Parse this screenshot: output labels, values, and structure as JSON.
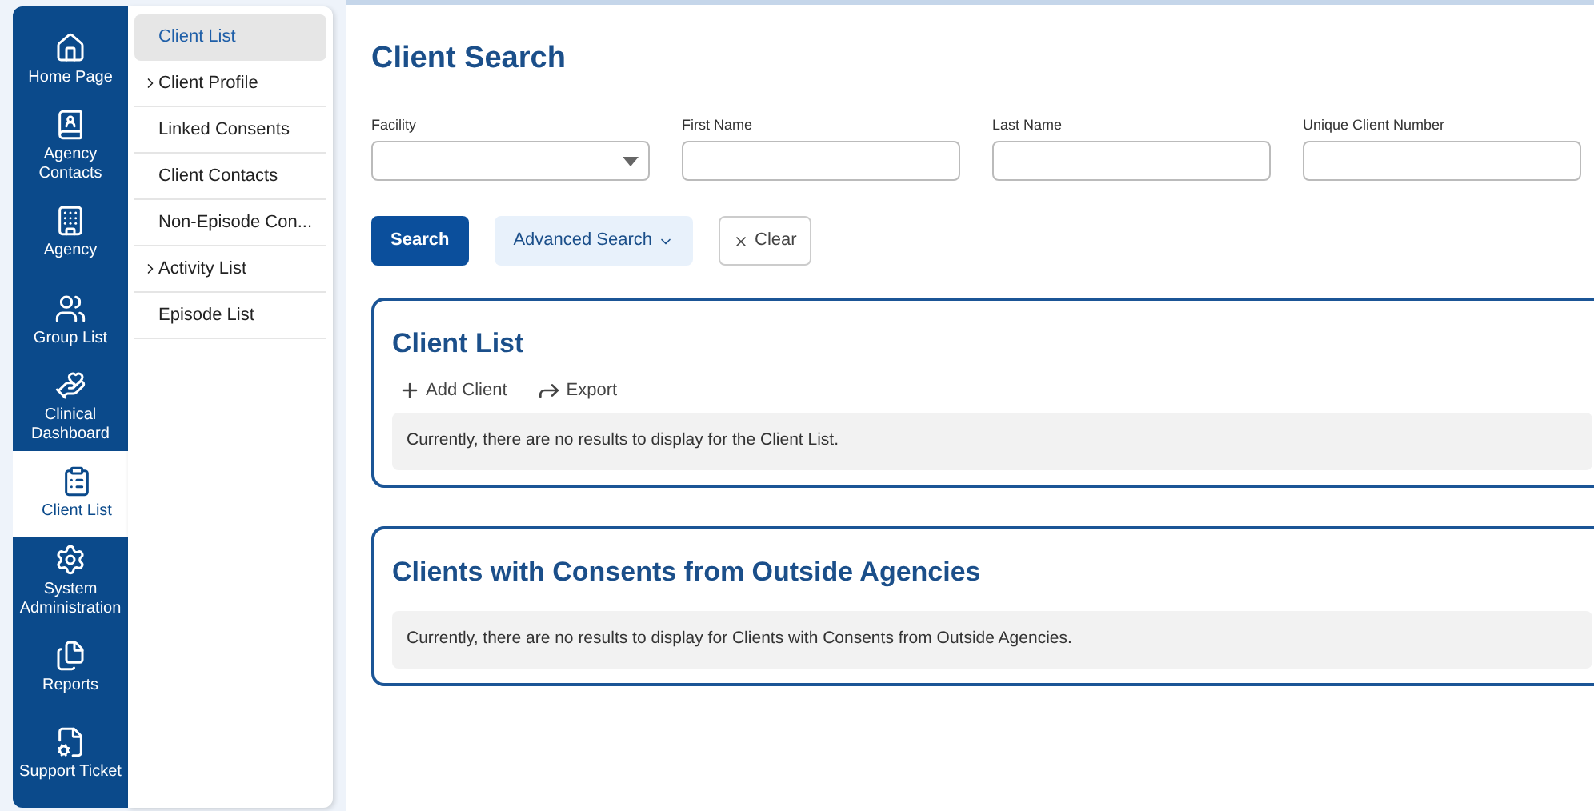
{
  "nav": [
    {
      "kind": "home",
      "label": [
        "Home Page"
      ],
      "selected": false
    },
    {
      "kind": "contacts",
      "label": [
        "Agency",
        "Contacts"
      ],
      "selected": false
    },
    {
      "kind": "building",
      "label": [
        "Agency"
      ],
      "selected": false
    },
    {
      "kind": "group",
      "label": [
        "Group List"
      ],
      "selected": false
    },
    {
      "kind": "dashboard",
      "label": [
        "Clinical",
        "Dashboard"
      ],
      "selected": false
    },
    {
      "kind": "clipboard",
      "label": [
        "Client List"
      ],
      "selected": true
    },
    {
      "kind": "gear",
      "label": [
        "System",
        "Administration"
      ],
      "selected": false
    },
    {
      "kind": "files",
      "label": [
        "Reports"
      ],
      "selected": false
    },
    {
      "kind": "ticket",
      "label": [
        "Support Ticket"
      ],
      "selected": false
    }
  ],
  "submenu": [
    {
      "label": "Client List",
      "expandable": false,
      "selected": true
    },
    {
      "label": "Client Profile",
      "expandable": true,
      "selected": false
    },
    {
      "label": "Linked Consents",
      "expandable": false,
      "selected": false
    },
    {
      "label": "Client Contacts",
      "expandable": false,
      "selected": false
    },
    {
      "label": "Non-Episode Con...",
      "expandable": false,
      "selected": false
    },
    {
      "label": "Activity List",
      "expandable": true,
      "selected": false
    },
    {
      "label": "Episode List",
      "expandable": false,
      "selected": false
    }
  ],
  "search": {
    "title": "Client Search",
    "fields": [
      {
        "kind": "select",
        "label": "Facility"
      },
      {
        "kind": "text",
        "label": "First Name"
      },
      {
        "kind": "text",
        "label": "Last Name"
      },
      {
        "kind": "text",
        "label": "Unique Client Number"
      }
    ],
    "buttons": [
      {
        "kind": "primary",
        "label": "Search"
      },
      {
        "kind": "dropdown",
        "label": "Advanced Search"
      },
      {
        "kind": "clear",
        "label": "Clear"
      }
    ]
  },
  "panels": [
    {
      "title": "Client List",
      "actions": [
        {
          "kind": "add",
          "label": "Add Client"
        },
        {
          "kind": "export",
          "label": "Export"
        }
      ],
      "empty": "Currently, there are no results to display for the Client List."
    },
    {
      "title": "Clients with Consents from Outside Agencies",
      "empty": "Currently, there are no results to display for Clients with Consents from Outside Agencies."
    }
  ]
}
